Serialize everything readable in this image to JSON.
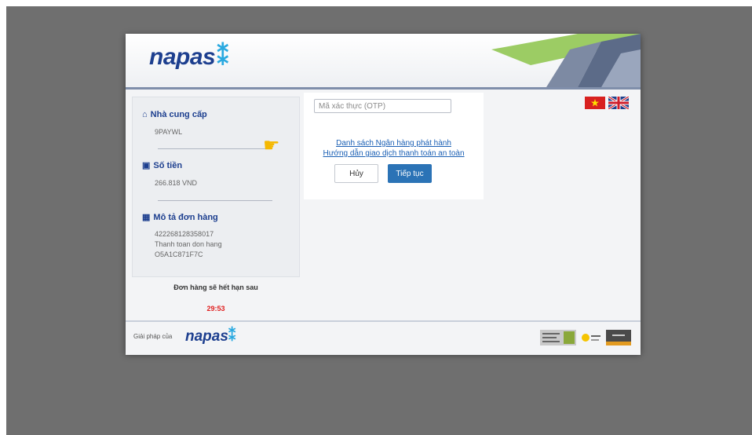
{
  "header": {
    "logo_text": "napas",
    "logo_mark": "⁑"
  },
  "languages": [
    {
      "name": "vi-flag-icon"
    },
    {
      "name": "uk-flag-icon"
    }
  ],
  "sidebar": {
    "provider": {
      "title": "Nhà cung cấp",
      "value": "9PAYWL"
    },
    "amount": {
      "title": "Số tiền",
      "value": "266.818 VND"
    },
    "order": {
      "title": "Mô tả đơn hàng",
      "lines": [
        "422268128358017",
        "Thanh toan don hang",
        "O5A1C871F7C"
      ]
    },
    "expire_label": "Đơn hàng sẽ hết hạn sau",
    "timer": "29:53"
  },
  "otp": {
    "placeholder": "Mã xác thực (OTP)",
    "value": ""
  },
  "links": {
    "bank_list": "Danh sách Ngân hàng phát hành",
    "safe_guide": "Hướng dẫn giao dịch thanh toán an toàn"
  },
  "buttons": {
    "cancel": "Hủy",
    "continue": "Tiếp tục"
  },
  "footer": {
    "provided_by": "Giải pháp của",
    "logo_text": "napas",
    "logo_mark": "⁑"
  },
  "colors": {
    "brand_blue": "#1d3f8f",
    "accent_blue": "#2b73b6",
    "timer_red": "#e02020",
    "backdrop": "#6f6f6f"
  }
}
